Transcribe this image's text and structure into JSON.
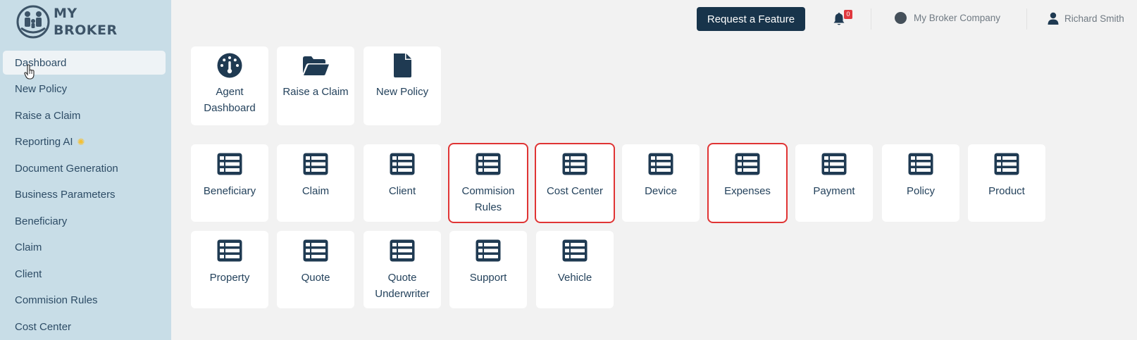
{
  "app": {
    "logo_line1": "MY",
    "logo_line2": "BROKER"
  },
  "sidebar": {
    "items": [
      {
        "label": "Dashboard",
        "active": true
      },
      {
        "label": "New Policy"
      },
      {
        "label": "Raise a Claim"
      },
      {
        "label": "Reporting AI",
        "badge_icon": "sparkle-icon"
      },
      {
        "label": "Document Generation"
      },
      {
        "label": "Business Parameters"
      },
      {
        "label": "Beneficiary"
      },
      {
        "label": "Claim"
      },
      {
        "label": "Client"
      },
      {
        "label": "Commision Rules"
      },
      {
        "label": "Cost Center"
      }
    ]
  },
  "header": {
    "feature_button": "Request a Feature",
    "notification_count": "0",
    "company": "My Broker Company",
    "user": "Richard Smith"
  },
  "quick_actions": [
    {
      "label": "Agent Dashboard",
      "icon": "gauge-icon"
    },
    {
      "label": "Raise a Claim",
      "icon": "folder-open-icon"
    },
    {
      "label": "New Policy",
      "icon": "file-icon"
    }
  ],
  "entities": [
    {
      "label": "Beneficiary",
      "icon": "table-list-icon"
    },
    {
      "label": "Claim",
      "icon": "table-list-icon"
    },
    {
      "label": "Client",
      "icon": "table-list-icon"
    },
    {
      "label": "Commision Rules",
      "icon": "table-list-icon",
      "highlighted": true
    },
    {
      "label": "Cost Center",
      "icon": "table-list-icon",
      "highlighted": true
    },
    {
      "label": "Device",
      "icon": "table-list-icon"
    },
    {
      "label": "Expenses",
      "icon": "table-list-icon",
      "highlighted": true
    },
    {
      "label": "Payment",
      "icon": "table-list-icon"
    },
    {
      "label": "Policy",
      "icon": "table-list-icon"
    },
    {
      "label": "Product",
      "icon": "table-list-icon"
    },
    {
      "label": "Property",
      "icon": "table-list-icon"
    },
    {
      "label": "Quote",
      "icon": "table-list-icon"
    },
    {
      "label": "Quote Underwriter",
      "icon": "table-list-icon"
    },
    {
      "label": "Support",
      "icon": "table-list-icon"
    },
    {
      "label": "Vehicle",
      "icon": "table-list-icon"
    }
  ],
  "colors": {
    "sidebar_bg": "#c8dde7",
    "page_bg": "#f2f2f2",
    "primary_dark": "#18344b",
    "icon": "#1f3a52",
    "highlight": "#e03434",
    "badge": "#e0383e"
  }
}
